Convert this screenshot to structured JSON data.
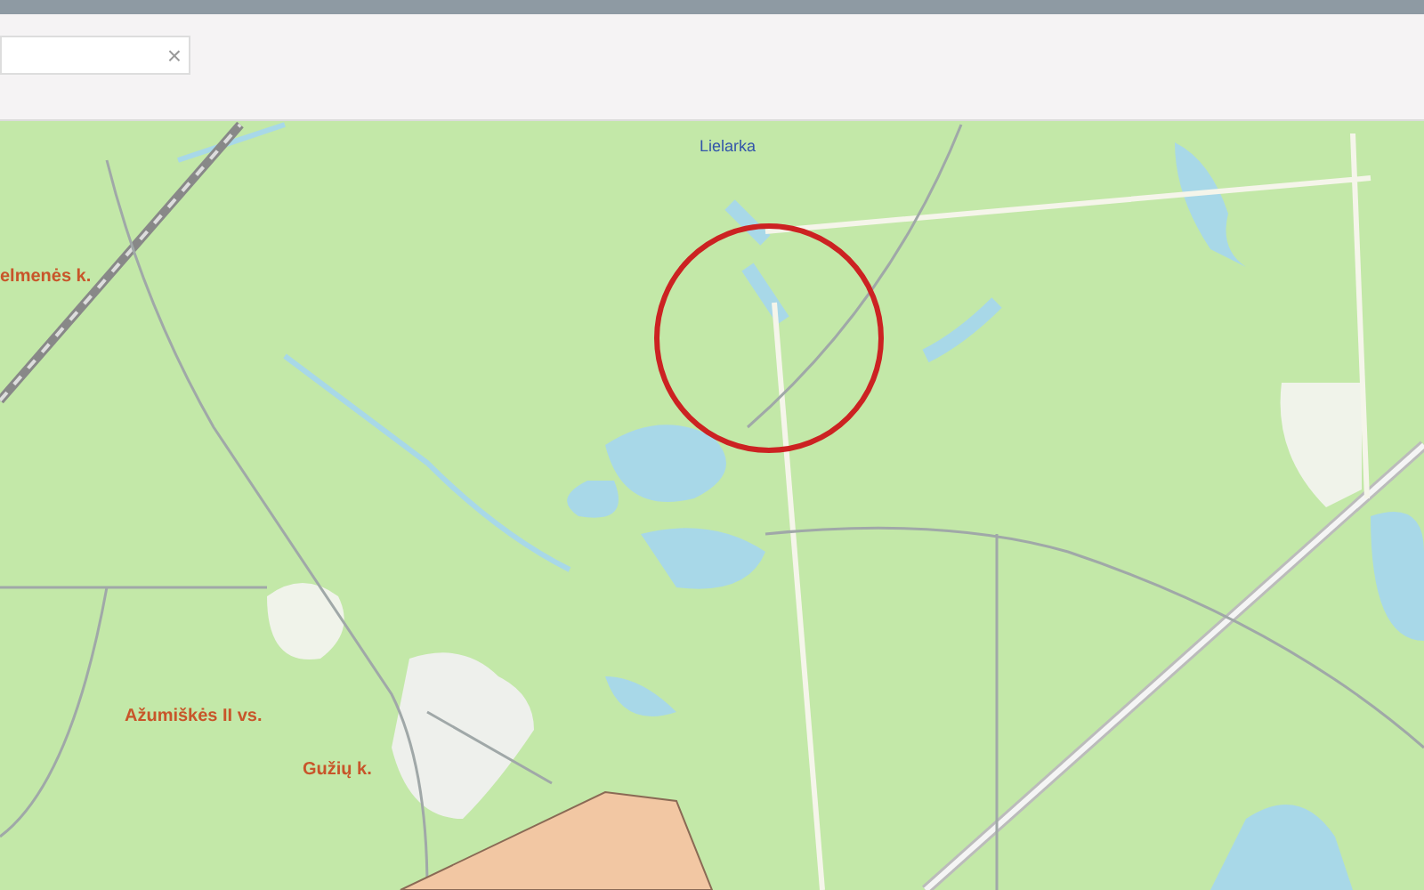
{
  "search": {
    "clear_icon": "×"
  },
  "map": {
    "labels": [
      {
        "text": "Lielarka",
        "kind": "water"
      },
      {
        "text": "elmenės k.",
        "kind": "place"
      },
      {
        "text": "Ažumiškės II vs.",
        "kind": "place"
      },
      {
        "text": "Gužių k.",
        "kind": "place"
      }
    ]
  }
}
